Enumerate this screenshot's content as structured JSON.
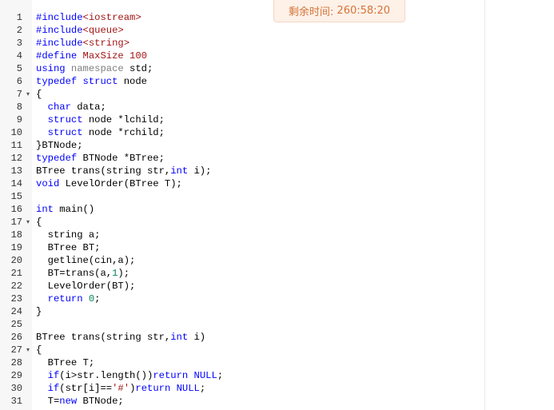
{
  "timer": {
    "label": "剩余时间:",
    "value": "260:58:20"
  },
  "code_lines": [
    {
      "n": "1",
      "fold": "",
      "tokens": [
        {
          "t": "#include",
          "c": "keyword"
        },
        {
          "t": "<iostream>",
          "c": "string"
        }
      ]
    },
    {
      "n": "2",
      "fold": "",
      "tokens": [
        {
          "t": "#include",
          "c": "keyword"
        },
        {
          "t": "<queue>",
          "c": "string"
        }
      ]
    },
    {
      "n": "3",
      "fold": "",
      "tokens": [
        {
          "t": "#include",
          "c": "keyword"
        },
        {
          "t": "<string>",
          "c": "string"
        }
      ]
    },
    {
      "n": "4",
      "fold": "",
      "tokens": [
        {
          "t": "#define ",
          "c": "keyword"
        },
        {
          "t": "MaxSize ",
          "c": "string"
        },
        {
          "t": "100",
          "c": "string"
        }
      ]
    },
    {
      "n": "5",
      "fold": "",
      "tokens": [
        {
          "t": "using ",
          "c": "keyword"
        },
        {
          "t": "namespace ",
          "c": "muted"
        },
        {
          "t": "std;",
          "c": "text"
        }
      ]
    },
    {
      "n": "6",
      "fold": "",
      "tokens": [
        {
          "t": "typedef ",
          "c": "keyword"
        },
        {
          "t": "struct ",
          "c": "keyword"
        },
        {
          "t": "node",
          "c": "text"
        }
      ]
    },
    {
      "n": "7",
      "fold": "▾",
      "tokens": [
        {
          "t": "{",
          "c": "text"
        }
      ]
    },
    {
      "n": "8",
      "fold": "",
      "tokens": [
        {
          "t": "  ",
          "c": "text"
        },
        {
          "t": "char ",
          "c": "keyword"
        },
        {
          "t": "data;",
          "c": "text"
        }
      ]
    },
    {
      "n": "9",
      "fold": "",
      "tokens": [
        {
          "t": "  ",
          "c": "text"
        },
        {
          "t": "struct ",
          "c": "keyword"
        },
        {
          "t": "node *lchild;",
          "c": "text"
        }
      ]
    },
    {
      "n": "10",
      "fold": "",
      "tokens": [
        {
          "t": "  ",
          "c": "text"
        },
        {
          "t": "struct ",
          "c": "keyword"
        },
        {
          "t": "node *rchild;",
          "c": "text"
        }
      ]
    },
    {
      "n": "11",
      "fold": "",
      "tokens": [
        {
          "t": "}BTNode;",
          "c": "text"
        }
      ]
    },
    {
      "n": "12",
      "fold": "",
      "tokens": [
        {
          "t": "typedef ",
          "c": "keyword"
        },
        {
          "t": "BTNode *BTree;",
          "c": "text"
        }
      ]
    },
    {
      "n": "13",
      "fold": "",
      "tokens": [
        {
          "t": "BTree trans(string str,",
          "c": "text"
        },
        {
          "t": "int ",
          "c": "keyword"
        },
        {
          "t": "i);",
          "c": "text"
        }
      ]
    },
    {
      "n": "14",
      "fold": "",
      "tokens": [
        {
          "t": "void ",
          "c": "keyword"
        },
        {
          "t": "LevelOrder(BTree T);",
          "c": "text"
        }
      ]
    },
    {
      "n": "15",
      "fold": "",
      "tokens": []
    },
    {
      "n": "16",
      "fold": "",
      "tokens": [
        {
          "t": "int ",
          "c": "keyword"
        },
        {
          "t": "main()",
          "c": "text"
        }
      ]
    },
    {
      "n": "17",
      "fold": "▾",
      "tokens": [
        {
          "t": "{",
          "c": "text"
        }
      ]
    },
    {
      "n": "18",
      "fold": "",
      "tokens": [
        {
          "t": "  string a;",
          "c": "text"
        }
      ]
    },
    {
      "n": "19",
      "fold": "",
      "tokens": [
        {
          "t": "  BTree BT;",
          "c": "text"
        }
      ]
    },
    {
      "n": "20",
      "fold": "",
      "tokens": [
        {
          "t": "  getline(cin,a);",
          "c": "text"
        }
      ]
    },
    {
      "n": "21",
      "fold": "",
      "tokens": [
        {
          "t": "  BT=trans(a,",
          "c": "text"
        },
        {
          "t": "1",
          "c": "number"
        },
        {
          "t": ");",
          "c": "text"
        }
      ]
    },
    {
      "n": "22",
      "fold": "",
      "tokens": [
        {
          "t": "  LevelOrder(BT);",
          "c": "text"
        }
      ]
    },
    {
      "n": "23",
      "fold": "",
      "tokens": [
        {
          "t": "  ",
          "c": "text"
        },
        {
          "t": "return ",
          "c": "keyword"
        },
        {
          "t": "0",
          "c": "number"
        },
        {
          "t": ";",
          "c": "text"
        }
      ]
    },
    {
      "n": "24",
      "fold": "",
      "tokens": [
        {
          "t": "}",
          "c": "text"
        }
      ]
    },
    {
      "n": "25",
      "fold": "",
      "tokens": []
    },
    {
      "n": "26",
      "fold": "",
      "tokens": [
        {
          "t": "BTree trans(string str,",
          "c": "text"
        },
        {
          "t": "int ",
          "c": "keyword"
        },
        {
          "t": "i)",
          "c": "text"
        }
      ]
    },
    {
      "n": "27",
      "fold": "▾",
      "tokens": [
        {
          "t": "{",
          "c": "text"
        }
      ]
    },
    {
      "n": "28",
      "fold": "",
      "tokens": [
        {
          "t": "  BTree T;",
          "c": "text"
        }
      ]
    },
    {
      "n": "29",
      "fold": "",
      "tokens": [
        {
          "t": "  ",
          "c": "text"
        },
        {
          "t": "if",
          "c": "keyword"
        },
        {
          "t": "(i>str.length())",
          "c": "text"
        },
        {
          "t": "return ",
          "c": "keyword"
        },
        {
          "t": "NULL",
          "c": "keyword"
        },
        {
          "t": ";",
          "c": "text"
        }
      ]
    },
    {
      "n": "30",
      "fold": "",
      "tokens": [
        {
          "t": "  ",
          "c": "text"
        },
        {
          "t": "if",
          "c": "keyword"
        },
        {
          "t": "(str[i]==",
          "c": "text"
        },
        {
          "t": "'#'",
          "c": "string"
        },
        {
          "t": ")",
          "c": "text"
        },
        {
          "t": "return ",
          "c": "keyword"
        },
        {
          "t": "NULL",
          "c": "keyword"
        },
        {
          "t": ";",
          "c": "text"
        }
      ]
    },
    {
      "n": "31",
      "fold": "",
      "tokens": [
        {
          "t": "  T=",
          "c": "text"
        },
        {
          "t": "new ",
          "c": "keyword"
        },
        {
          "t": "BTNode;",
          "c": "text"
        }
      ]
    }
  ]
}
